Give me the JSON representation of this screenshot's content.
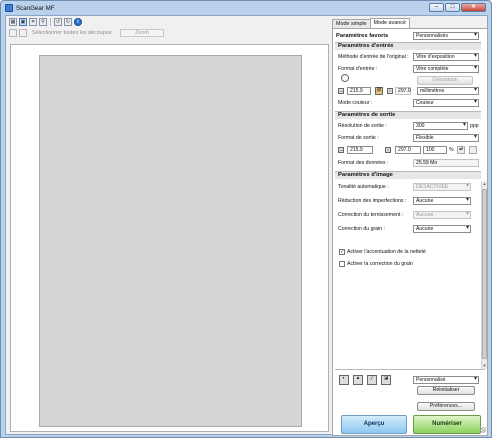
{
  "window": {
    "title": "ScanGear MF",
    "minimize": "–",
    "maximize": "□",
    "close": "✕"
  },
  "toolbar": {
    "icons": [
      "thumbnail-icon",
      "whole-image-icon",
      "crop-icon",
      "zoom-icon",
      "rotate-left-icon",
      "rotate-right-icon",
      "info-icon"
    ],
    "select_all_crop": "Sélectionner toutes les découpes",
    "zoom": "Zoom"
  },
  "tabs": {
    "simple": "Mode simple",
    "advanced": "Mode avancé"
  },
  "favorites": {
    "heading": "Paramètres favoris",
    "value": "Personnalisés"
  },
  "input": {
    "heading": "Paramètres d'entrée",
    "source_label": "Méthode d'entrée de l'original :",
    "source_value": "Vitre d'exposition",
    "format_label": "Format d'entrée :",
    "format_value": "Vitre complète",
    "orientation": "Orientation",
    "width": "215.9",
    "height": "297.0",
    "unit": "millimètres",
    "color_label": "Mode couleur :",
    "color_value": "Couleur"
  },
  "output": {
    "heading": "Paramètres de sortie",
    "resolution_label": "Résolution de sortie :",
    "resolution_value": "300",
    "resolution_unit": "ppp",
    "format_label": "Format de sortie :",
    "format_value": "Flexible",
    "width": "215.9",
    "height": "297.0",
    "scale": "100",
    "scale_unit": "%",
    "data_size_label": "Format des données :",
    "data_size_value": "25.59 Mo"
  },
  "image": {
    "heading": "Paramètres d'image",
    "auto_tone_label": "Tonalité automatique :",
    "auto_tone_value": "DÉSACTIVÉE",
    "reduce_label": "Réduction des imperfections :",
    "reduce_value": "Aucune",
    "fading_label": "Correction du ternissement :",
    "fading_value": "Aucune",
    "grain_label": "Correction du grain :",
    "grain_value": "Aucune",
    "sharpen_label": "Activer l'accentuation de la netteté",
    "sharpen_checked": true,
    "grain_corr_label": "Activer la correction du grain",
    "grain_corr_checked": false
  },
  "bottom": {
    "preset_value": "Personnalisé",
    "reset": "Réinitialiser",
    "preferences": "Préférences...",
    "preview": "Aperçu",
    "scan": "Numériser"
  }
}
